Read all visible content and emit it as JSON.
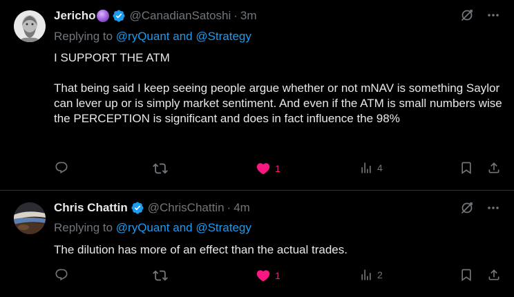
{
  "tweets": [
    {
      "name": "Jericho",
      "handle": "@CanadianSatoshi",
      "time": "3m",
      "replying_prefix": "Replying to ",
      "replying_users": "@ryQuant and @Strategy",
      "paragraphs": [
        "I SUPPORT THE ATM",
        "That being said I keep seeing people argue whether or not mNAV is something Saylor can lever up or is simply market sentiment. And even if the ATM is small numbers wise the PERCEPTION is significant and does in fact influence the 98%"
      ],
      "likes": "1",
      "views": "4"
    },
    {
      "name": "Chris Chattin",
      "handle": "@ChrisChattin",
      "time": "4m",
      "replying_prefix": "Replying to ",
      "replying_users": "@ryQuant and @Strategy",
      "paragraphs": [
        "The dilution has more of an effect than the actual trades."
      ],
      "likes": "1",
      "views": "2"
    }
  ],
  "separator": "·",
  "colors": {
    "background": "#000000",
    "text": "#e7e9ea",
    "muted": "#71767b",
    "link": "#1d9bf0",
    "like": "#f91880",
    "verified": "#1d9bf0"
  },
  "icons": [
    "reply-icon",
    "retweet-icon",
    "heart-icon",
    "views-icon",
    "bookmark-icon",
    "share-icon",
    "grok-icon",
    "more-icon",
    "verified-icon"
  ]
}
